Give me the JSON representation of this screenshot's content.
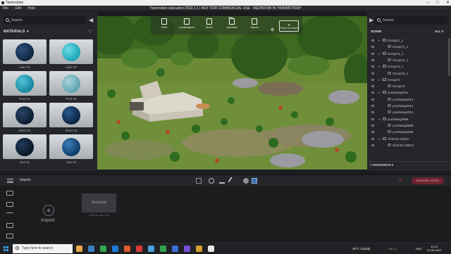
{
  "window": {
    "app_name": "Twinmotion",
    "title": "Twinmotion education 2022.2.1 | NOT FOR COMMERCIAL USE - BEDROOM IN TWINMOTION*",
    "controls": [
      "–",
      "□",
      "✕"
    ]
  },
  "menu": [
    "File",
    "Edit",
    "Help"
  ],
  "left_panel": {
    "search_placeholder": "Search",
    "section_title": "MATERIALS",
    "materials": [
      {
        "name": "Lake 01",
        "color": "#0f2740",
        "highlight": "#2b4f7a"
      },
      {
        "name": "Lake 02",
        "color": "#1aa6b8",
        "highlight": "#6fdbe6"
      },
      {
        "name": "Pool 01",
        "color": "#1587a0",
        "highlight": "#52c3d6"
      },
      {
        "name": "Pool 02",
        "color": "#5fa3b0",
        "highlight": "#a9d5de"
      },
      {
        "name": "River 01",
        "color": "#0c1c30",
        "highlight": "#28446a"
      },
      {
        "name": "River 02",
        "color": "#0a2240",
        "highlight": "#2b5a8c"
      },
      {
        "name": "Sea 01",
        "color": "#081726",
        "highlight": "#1f3a5c"
      },
      {
        "name": "Sea 02",
        "color": "#0b3a66",
        "highlight": "#3f7fb8"
      }
    ]
  },
  "viewport_toolbar": {
    "tools": [
      "Orbit",
      "Landscaped",
      "Move",
      "Up/down",
      "Speed"
    ],
    "speed_badge": "Max",
    "push_to_cloud": "Push to Cloud"
  },
  "right_panel": {
    "search_placeholder": "Search",
    "scene_label": "SCENE",
    "filter_label": "ALL",
    "tree": [
      {
        "label": "Group11_1",
        "kind": "group",
        "indent": 1,
        "expandable": true
      },
      {
        "label": "Group71_1",
        "kind": "item",
        "indent": 2,
        "expandable": false
      },
      {
        "label": "Group74_1",
        "kind": "group",
        "indent": 1,
        "expandable": true
      },
      {
        "label": "Group74_1",
        "kind": "item",
        "indent": 2,
        "expandable": false
      },
      {
        "label": "Group73_1",
        "kind": "group",
        "indent": 1,
        "expandable": true
      },
      {
        "label": "Group73_1",
        "kind": "item",
        "indent": 2,
        "expandable": false
      },
      {
        "label": "Group72",
        "kind": "group",
        "indent": 1,
        "expandable": true
      },
      {
        "label": "Group72",
        "kind": "item",
        "indent": 2,
        "expandable": false
      },
      {
        "label": "youshang2014",
        "kind": "group",
        "indent": 1,
        "expandable": true
      },
      {
        "label": "youshang2014",
        "kind": "item",
        "indent": 2,
        "expandable": false
      },
      {
        "label": "youshang2014",
        "kind": "item",
        "indent": 2,
        "expandable": false
      },
      {
        "label": "youshang2014",
        "kind": "item",
        "indent": 2,
        "expandable": false
      },
      {
        "label": "youshang3568",
        "kind": "group",
        "indent": 1,
        "expandable": true
      },
      {
        "label": "youshang3568",
        "kind": "item",
        "indent": 2,
        "expandable": false
      },
      {
        "label": "youshang3568",
        "kind": "item",
        "indent": 2,
        "expandable": false
      },
      {
        "label": "ChenZo-23812",
        "kind": "group",
        "indent": 1,
        "expandable": true
      },
      {
        "label": "ChenZo-23812",
        "kind": "item",
        "indent": 2,
        "expandable": false
      }
    ],
    "statistics_label": "STATISTICS"
  },
  "dock": {
    "title": "Import",
    "import_label": "Import",
    "card_title": "SketchUp",
    "card_name": "MOTION_BED_2780",
    "render_label": "Generate render"
  },
  "taskbar": {
    "search_placeholder": "Type here to search",
    "weather": "26°C  Cloudy",
    "language": "ENG",
    "time": "10:13",
    "date": "12-09-2022",
    "apps": [
      "#e8a84a",
      "#3b82c4",
      "#2fa84f",
      "#1f7ad6",
      "#e05a2b",
      "#d63a3a",
      "#4aa3df",
      "#2ea44f",
      "#3c6fd6",
      "#7a4fd6",
      "#d6a02b",
      "#e8e8e8"
    ]
  }
}
